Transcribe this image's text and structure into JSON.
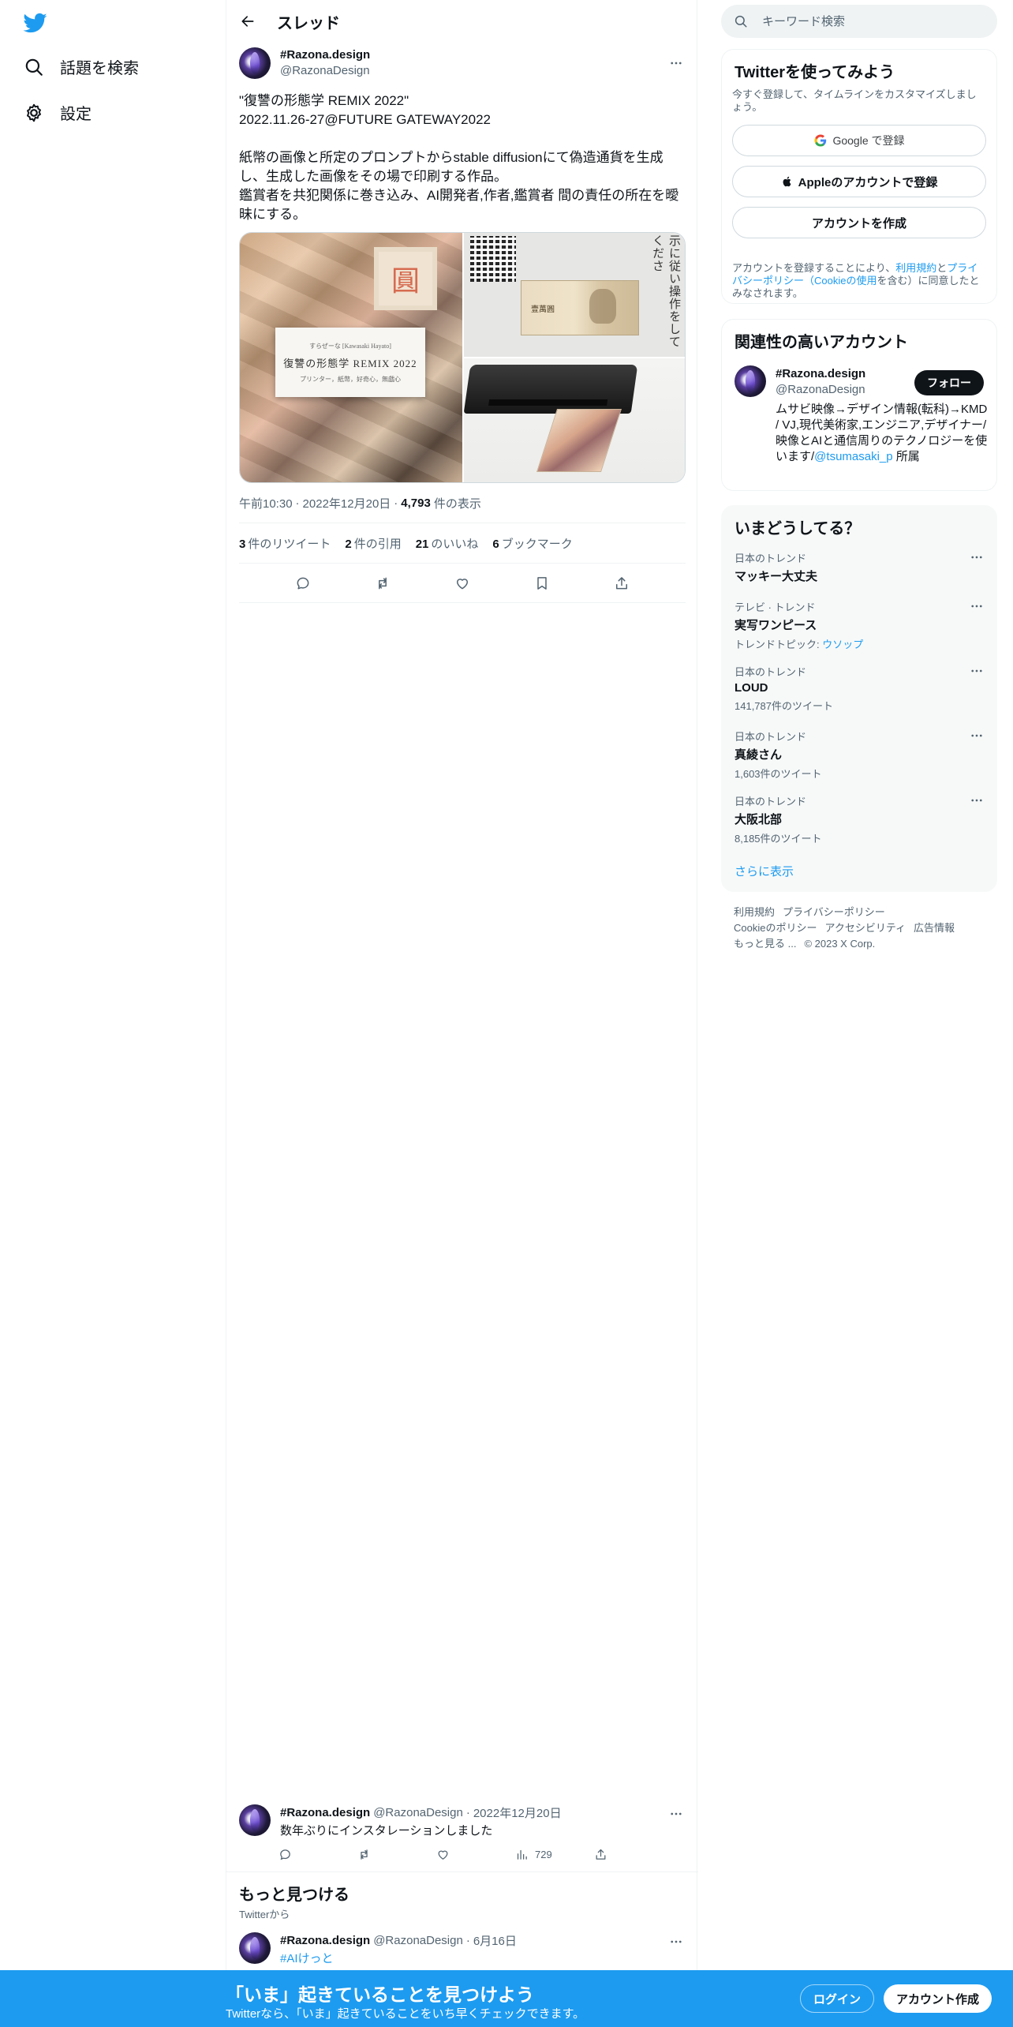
{
  "nav": {
    "logo_icon": "twitter-bird-icon",
    "brand_color": "#1d9bf0",
    "items": [
      {
        "label": "話題を検索",
        "icon": "search-icon"
      },
      {
        "label": "設定",
        "icon": "gear-icon"
      }
    ]
  },
  "header": {
    "title": "スレッド"
  },
  "post": {
    "display_name": "#Razona.design",
    "handle": "@RazonaDesign",
    "text": "\"復讐の形態学 REMIX 2022\"\n2022.11.26-27@FUTURE GATEWAY2022\n\n紙幣の画像と所定のプロンプトからstable diffusionにて偽造通貨を生成し、生成した画像をその場で印刷する作品。\n鑑賞者を共犯関係に巻き込み、AI開発者,作者,鑑賞者 間の責任の所在を曖昧にする。",
    "media": {
      "card_line1": "すらぜーな [Kawasaki Hayato]",
      "card_title": "復讐の形態学 REMIX 2022",
      "card_line3": "プリンター，紙幣，好奇心，無戯心",
      "stamp": "圓",
      "bill": "壹萬圓",
      "vertical_text": "示に従い操作をしてくださ"
    },
    "time": "午前10:30",
    "date": "2022年12月20日",
    "views_count": "4,793",
    "views_label": "件の表示",
    "stats": [
      {
        "count": "3",
        "label": "件のリツイート"
      },
      {
        "count": "2",
        "label": "件の引用"
      },
      {
        "count": "21",
        "label": "のいいね"
      },
      {
        "count": "6",
        "label": "ブックマーク"
      }
    ]
  },
  "reply": {
    "display_name": "#Razona.design",
    "handle": "@RazonaDesign",
    "date": "2022年12月20日",
    "text": "数年ぶりにインスタレーションしました",
    "views": "729"
  },
  "discover": {
    "title": "もっと見つける",
    "subtitle": "Twitterから",
    "post": {
      "display_name": "#Razona.design",
      "handle": "@RazonaDesign",
      "date": "6月16日",
      "tag": "#AIけっと"
    }
  },
  "search": {
    "placeholder": "キーワード検索"
  },
  "signup": {
    "title": "Twitterを使ってみよう",
    "subtitle": "今すぐ登録して、タイムラインをカスタマイズしましょう。",
    "google": "Google で登録",
    "apple": "Appleのアカウントで登録",
    "create": "アカウントを作成",
    "legal_1": "アカウントを登録することにより、",
    "legal_tos": "利用規約",
    "legal_and": "と",
    "legal_privacy": "プライバシーポリシー",
    "legal_paren_open": "（",
    "legal_cookie": "Cookieの使用",
    "legal_2": "を含む）に同意したとみなされます。"
  },
  "related": {
    "title": "関連性の高いアカウント",
    "display_name": "#Razona.design",
    "handle": "@RazonaDesign",
    "follow": "フォロー",
    "bio": "ムサビ映像→デザイン情報(転科)→KMD / VJ,現代美術家,エンジニア,デザイナー/映像とAIと通信周りのテクノロジーを使います/",
    "bio_link": "@tsumasaki_p",
    "bio_end": " 所属"
  },
  "trends": {
    "title": "いまどうしてる？",
    "items": [
      {
        "context": "日本のトレンド",
        "name": "マッキー大丈夫",
        "sub": ""
      },
      {
        "context": "テレビ · トレンド",
        "name": "実写ワンピース",
        "sub": "トレンドトピック: ",
        "sub_link": "ウソップ"
      },
      {
        "context": "日本のトレンド",
        "name": "LOUD",
        "sub": "141,787件のツイート"
      },
      {
        "context": "日本のトレンド",
        "name": "真綾さん",
        "sub": "1,603件のツイート"
      },
      {
        "context": "日本のトレンド",
        "name": "大阪北部",
        "sub": "8,185件のツイート"
      }
    ],
    "show_more": "さらに表示"
  },
  "footer": {
    "links": [
      "利用規約",
      "プライバシーポリシー",
      "Cookieのポリシー",
      "アクセシビリティ",
      "広告情報",
      "もっと見る ..."
    ],
    "copyright": "© 2023 X Corp."
  },
  "banner": {
    "title": "「いま」起きていることを見つけよう",
    "subtitle": "Twitterなら、「いま」起きていることをいち早くチェックできます。",
    "login": "ログイン",
    "signup": "アカウント作成"
  }
}
